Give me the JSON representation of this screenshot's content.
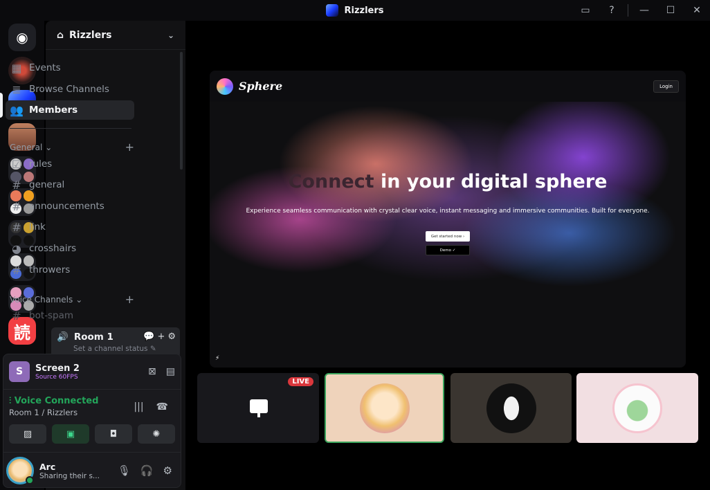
{
  "window": {
    "title": "Rizzlers"
  },
  "guild": {
    "name": "Rizzlers",
    "nav": [
      {
        "label": "Events",
        "icon": "calendar-icon"
      },
      {
        "label": "Browse Channels",
        "icon": "browse-icon"
      },
      {
        "label": "Members",
        "icon": "members-icon"
      }
    ],
    "categories": {
      "general": "General",
      "voice": "Voice Channels"
    },
    "text_channels": [
      {
        "label": "rules",
        "icon": "rules-icon"
      },
      {
        "label": "general",
        "icon": "hash-icon"
      },
      {
        "label": "announcements",
        "icon": "hash-icon"
      },
      {
        "label": "link",
        "icon": "hash-icon"
      },
      {
        "label": "crosshairs",
        "icon": "thread-icon"
      },
      {
        "label": "throwers",
        "icon": "locked-hash-icon"
      },
      {
        "label": "bot-spam",
        "icon": "hash-icon"
      }
    ],
    "voice_channel": {
      "name": "Room 1",
      "status_placeholder": "Set a channel status"
    }
  },
  "stream_panel": {
    "avatar_letter": "S",
    "title": "Screen 2",
    "source": "Source 60FPS"
  },
  "voice_panel": {
    "status": "Voice Connected",
    "location": "Room 1 / Rizzlers"
  },
  "user": {
    "name": "Arc",
    "status": "Sharing their s..."
  },
  "stream_page": {
    "brand": "Sphere",
    "login": "Login",
    "hero_title_dim": "Connect",
    "hero_title": "in your digital sphere",
    "hero_subtitle": "Experience seamless communication with crystal clear voice, instant messaging and immersive communities. Built for everyone.",
    "cta_primary": "Get started now ›",
    "cta_secondary": "Demo ✓"
  },
  "tiles": {
    "live_badge": "LIVE"
  },
  "colors": {
    "accent_green": "#23a55a",
    "live_red": "#da373c",
    "sidebar_bg": "#121214"
  }
}
